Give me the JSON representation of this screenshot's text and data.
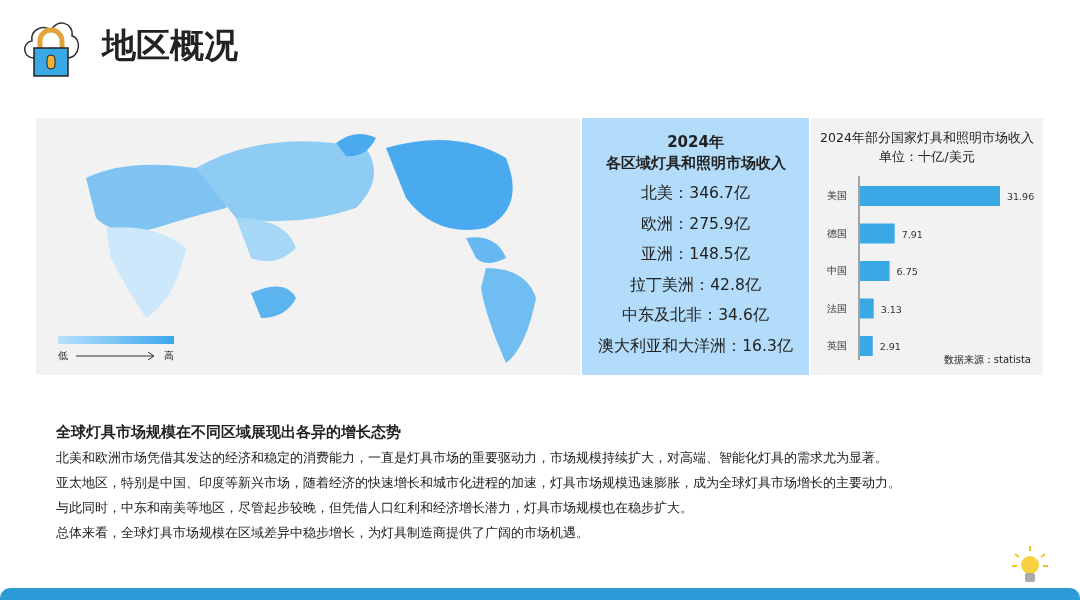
{
  "header": {
    "title": "地区概况"
  },
  "map": {
    "legend": {
      "low": "低",
      "high": "高"
    }
  },
  "regions_panel": {
    "year": "2024年",
    "title": "各区域灯具和照明市场收入",
    "items": [
      "北美：346.7亿",
      "欧洲：275.9亿",
      "亚洲：148.5亿",
      "拉丁美洲：42.8亿",
      "中东及北非：34.6亿",
      "澳大利亚和大洋洲：16.3亿"
    ]
  },
  "country_chart": {
    "title": "2024年部分国家灯具和照明市场收入",
    "unit": "单位：十亿/美元",
    "source": "数据来源：statista",
    "chart_data": {
      "type": "bar",
      "orientation": "horizontal",
      "categories": [
        "美国",
        "德国",
        "中国",
        "法国",
        "英国"
      ],
      "series": [
        {
          "color": "#3aa8e4",
          "values": [
            31.96,
            7.91,
            6.75,
            3.13,
            2.91
          ]
        }
      ],
      "data_labels": true
    }
  },
  "summary": {
    "heading": "全球灯具市场规模在不同区域展现出各异的增长态势",
    "paragraphs": [
      "北美和欧洲市场凭借其发达的经济和稳定的消费能力，一直是灯具市场的重要驱动力，市场规模持续扩大，对高端、智能化灯具的需求尤为显著。",
      "亚太地区，特别是中国、印度等新兴市场，随着经济的快速增长和城市化进程的加速，灯具市场规模迅速膨胀，成为全球灯具市场增长的主要动力。",
      "与此同时，中东和南美等地区，尽管起步较晚，但凭借人口红利和经济增长潜力，灯具市场规模也在稳步扩大。",
      "总体来看，全球灯具市场规模在区域差异中稳步增长，为灯具制造商提供了广阔的市场机遇。"
    ]
  }
}
